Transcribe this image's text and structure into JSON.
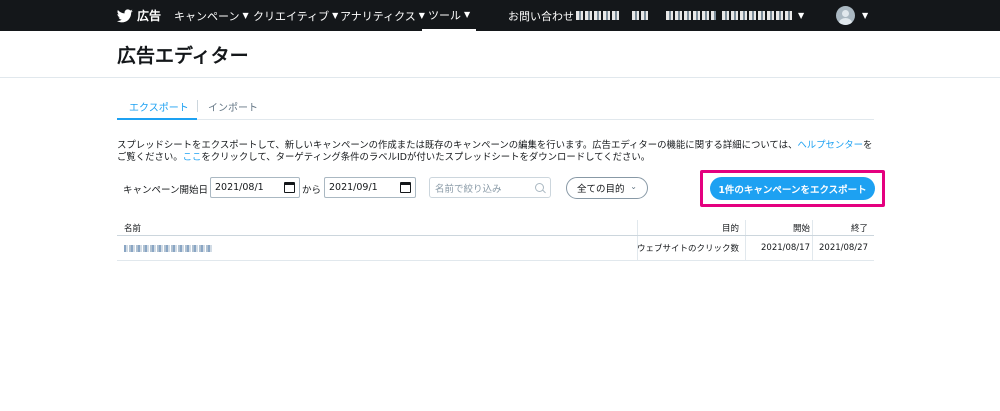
{
  "nav": {
    "brand": "広告",
    "items": [
      "キャンペーン",
      "クリエイティブ",
      "アナリティクス",
      "ツール"
    ],
    "active_index": 3,
    "contact": "お問い合わせ"
  },
  "page": {
    "title": "広告エディター"
  },
  "tabs": [
    {
      "label": "エクスポート",
      "active": true
    },
    {
      "label": "インポート",
      "active": false
    }
  ],
  "description": {
    "part1": "スプレッドシートをエクスポートして、新しいキャンペーンの作成または既存のキャンペーンの編集を行います。広告エディターの機能に関する詳細については、",
    "help_link": "ヘルプセンター",
    "part2": "をご覧ください。",
    "here_link": "ここ",
    "part3": "をクリックして、ターゲティング条件のラベルIDが付いたスプレッドシートをダウンロードしてください。"
  },
  "filters": {
    "start_label": "キャンペーン開始日",
    "start_date": "2021/08/1",
    "separator": "から",
    "end_date": "2021/09/1",
    "search_placeholder": "名前で絞り込み",
    "objective_select": "全ての目的"
  },
  "export_button": "1件のキャンペーンをエクスポート",
  "table": {
    "columns": [
      "名前",
      "目的",
      "開始",
      "終了"
    ],
    "rows": [
      {
        "objective": "ウェブサイトのクリック数",
        "start": "2021/08/17",
        "end": "2021/08/27"
      }
    ]
  },
  "colors": {
    "nav_bg": "#14171a",
    "accent": "#1da1f2",
    "highlight": "#e4007f"
  }
}
